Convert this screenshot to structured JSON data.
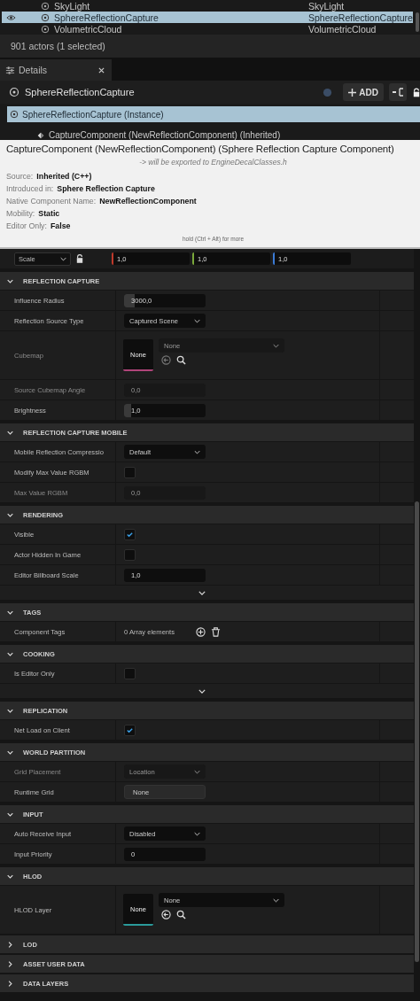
{
  "outliner": {
    "rows": [
      {
        "label": "SkyLight",
        "type": "SkyLight",
        "selected": false
      },
      {
        "label": "SphereReflectionCapture",
        "type": "SphereReflectionCapture",
        "selected": true
      },
      {
        "label": "VolumetricCloud",
        "type": "VolumetricCloud",
        "selected": false
      }
    ],
    "status": "901 actors (1 selected)"
  },
  "details": {
    "tab": "Details",
    "title": "SphereReflectionCapture",
    "add_button": "ADD",
    "components": [
      {
        "label": "SphereReflectionCapture  (Instance)",
        "selected": true,
        "children": [
          {
            "label": "CaptureComponent (NewReflectionComponent) (Inherited)",
            "selected": false
          }
        ]
      }
    ]
  },
  "tooltip": {
    "title": "CaptureComponent (NewReflectionComponent) (Sphere Reflection Capture Component)",
    "note": "-> will be exported to EngineDecalClasses.h",
    "fields": [
      {
        "label": "Source:",
        "value": "Inherited (C++)"
      },
      {
        "label": "Introduced in:",
        "value": "Sphere Reflection Capture"
      },
      {
        "label": "Native Component Name:",
        "value": "NewReflectionComponent"
      },
      {
        "label": "Mobility:",
        "value": "Static"
      },
      {
        "label": "Editor Only:",
        "value": "False"
      }
    ],
    "hint": "hold (Ctrl + Alt) for more"
  },
  "transform": {
    "mode": "Scale",
    "values": [
      "1,0",
      "1,0",
      "1,0"
    ]
  },
  "sections": [
    {
      "title": "REFLECTION CAPTURE",
      "expanded": true,
      "rows": [
        {
          "kind": "number",
          "label": "Influence Radius",
          "value": "3000,0",
          "level": 0.13,
          "disabled": false
        },
        {
          "kind": "dropdown",
          "label": "Reflection Source Type",
          "value": "Captured Scene",
          "disabled": false
        },
        {
          "kind": "asset",
          "label": "Cubemap",
          "thumb": "None",
          "value": "None",
          "color": "#b0457a",
          "disabled": true
        },
        {
          "kind": "number",
          "label": "Source Cubemap Angle",
          "value": "0,0",
          "disabled": true
        },
        {
          "kind": "number",
          "label": "Brightness",
          "value": "1,0",
          "level": 0.09,
          "disabled": false
        }
      ]
    },
    {
      "title": "REFLECTION CAPTURE MOBILE",
      "expanded": true,
      "rows": [
        {
          "kind": "dropdown",
          "label": "Mobile Reflection Compressio",
          "value": "Default",
          "disabled": false
        },
        {
          "kind": "checkbox",
          "label": "Modify Max Value RGBM",
          "checked": false,
          "disabled": false
        },
        {
          "kind": "number",
          "label": "Max Value RGBM",
          "value": "0,0",
          "disabled": true
        }
      ]
    },
    {
      "title": "RENDERING",
      "expanded": true,
      "advanced": true,
      "rows": [
        {
          "kind": "checkbox",
          "label": "Visible",
          "checked": true,
          "disabled": false
        },
        {
          "kind": "checkbox",
          "label": "Actor Hidden In Game",
          "checked": false,
          "disabled": false
        },
        {
          "kind": "number",
          "label": "Editor Billboard Scale",
          "value": "1,0",
          "disabled": false
        }
      ]
    },
    {
      "title": "TAGS",
      "expanded": true,
      "rows": [
        {
          "kind": "array",
          "label": "Component Tags",
          "value": "0 Array elements",
          "disabled": false
        }
      ]
    },
    {
      "title": "COOKING",
      "expanded": true,
      "advanced": true,
      "rows": [
        {
          "kind": "checkbox",
          "label": "Is Editor Only",
          "checked": false,
          "disabled": false
        }
      ]
    },
    {
      "title": "REPLICATION",
      "expanded": true,
      "rows": [
        {
          "kind": "checkbox",
          "label": "Net Load on Client",
          "checked": true,
          "disabled": false
        }
      ]
    },
    {
      "title": "WORLD PARTITION",
      "expanded": true,
      "rows": [
        {
          "kind": "dropdown",
          "label": "Grid Placement",
          "value": "Location",
          "disabled": true
        },
        {
          "kind": "button",
          "label": "Runtime Grid",
          "value": "None",
          "disabled": false
        }
      ]
    },
    {
      "title": "INPUT",
      "expanded": true,
      "rows": [
        {
          "kind": "dropdown",
          "label": "Auto Receive Input",
          "value": "Disabled",
          "disabled": false
        },
        {
          "kind": "number",
          "label": "Input Priority",
          "value": "0",
          "disabled": false
        }
      ]
    },
    {
      "title": "HLOD",
      "expanded": true,
      "rows": [
        {
          "kind": "asset",
          "label": "HLOD Layer",
          "thumb": "None",
          "value": "None",
          "color": "#2a9a9a",
          "disabled": false
        }
      ]
    },
    {
      "title": "LOD",
      "expanded": false
    },
    {
      "title": "ASSET USER DATA",
      "expanded": false
    },
    {
      "title": "DATA LAYERS",
      "expanded": false
    }
  ]
}
